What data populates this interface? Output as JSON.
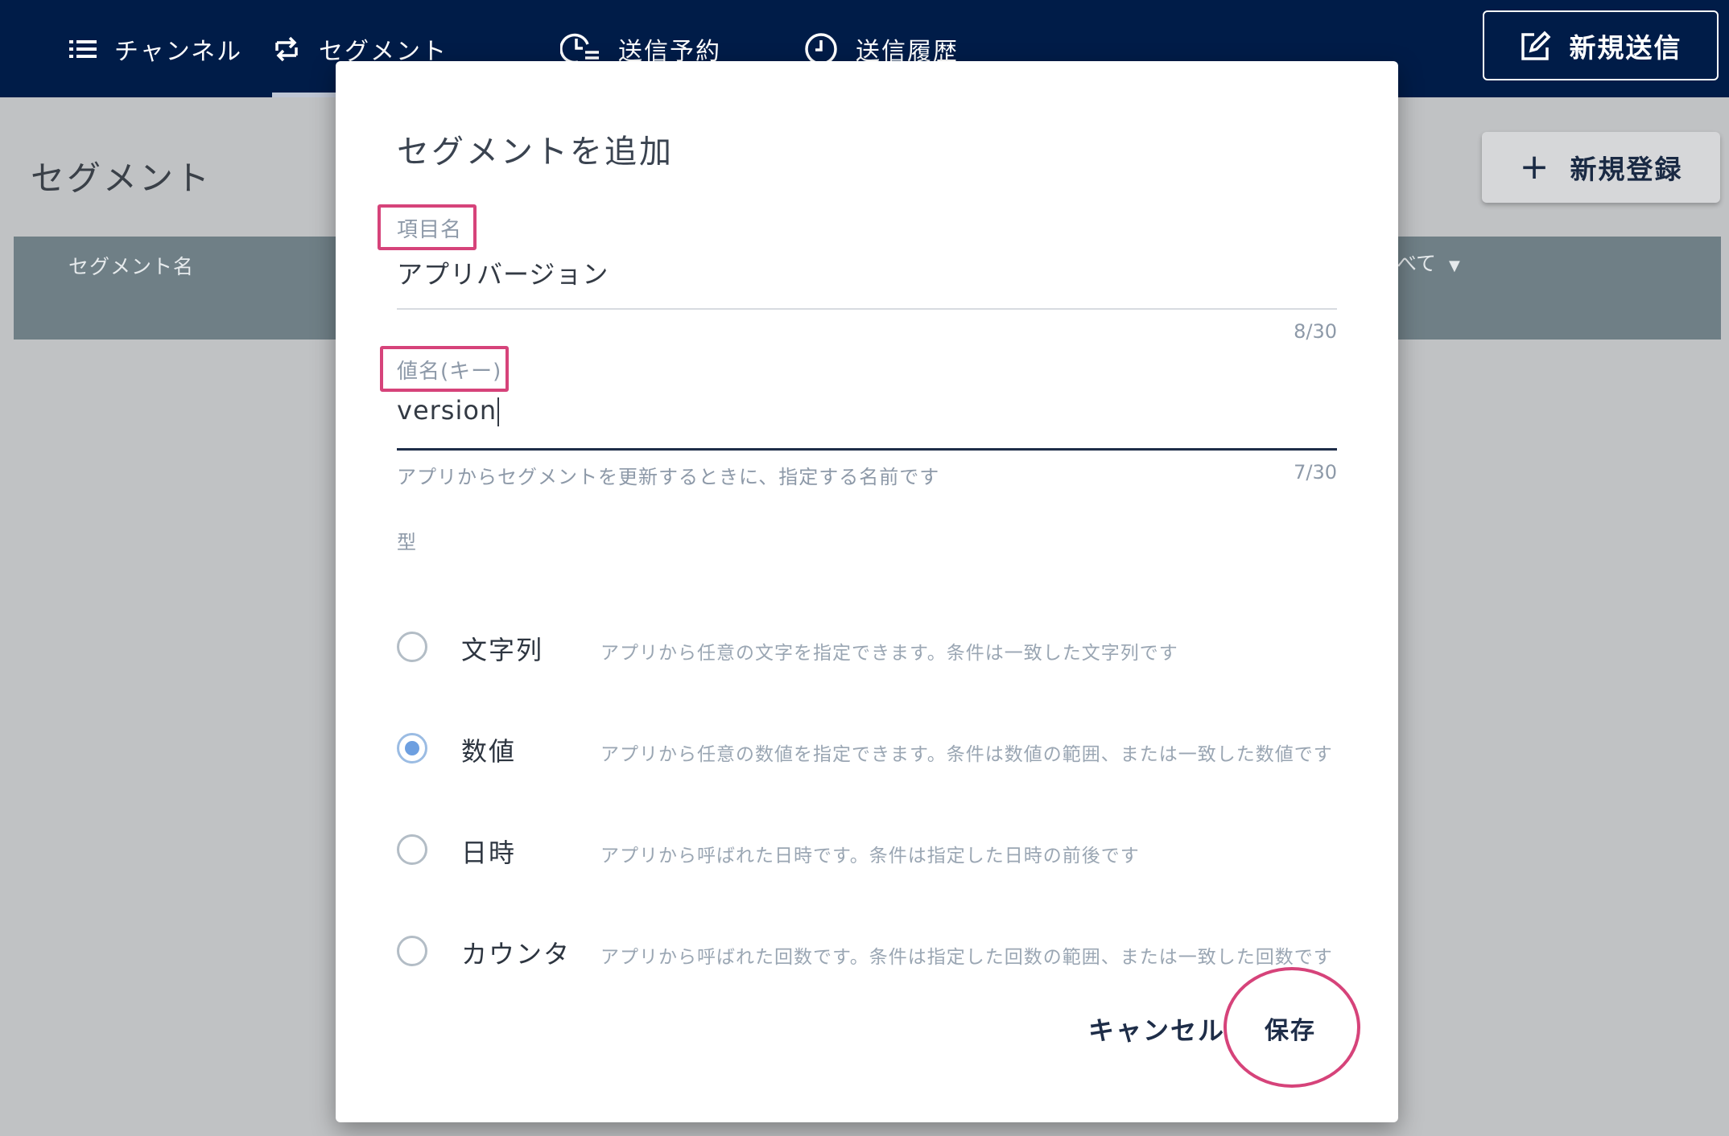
{
  "nav": {
    "items": [
      {
        "label": "チャンネル",
        "icon": "list-icon"
      },
      {
        "label": "セグメント",
        "icon": "swap-icon"
      },
      {
        "label": "送信予約",
        "icon": "clock-list-icon"
      },
      {
        "label": "送信履歴",
        "icon": "clock-icon"
      }
    ],
    "active_index": 1,
    "new_send_label": "新規送信"
  },
  "page": {
    "title": "セグメント",
    "register_label": "新規登録",
    "table": {
      "column_name": "セグメント名",
      "filter_partial": "べて"
    }
  },
  "modal": {
    "title": "セグメントを追加",
    "item_name": {
      "label": "項目名",
      "value": "アプリバージョン",
      "counter": "8/30"
    },
    "key_name": {
      "label": "値名(キー)",
      "value": "version",
      "helper": "アプリからセグメントを更新するときに、指定する名前です",
      "counter": "7/30"
    },
    "type": {
      "label": "型",
      "options": [
        {
          "label": "文字列",
          "description": "アプリから任意の文字を指定できます。条件は一致した文字列です",
          "selected": false
        },
        {
          "label": "数値",
          "description": "アプリから任意の数値を指定できます。条件は数値の範囲、または一致した数値です",
          "selected": true
        },
        {
          "label": "日時",
          "description": "アプリから呼ばれた日時です。条件は指定した日時の前後です",
          "selected": false
        },
        {
          "label": "カウンタ",
          "description": "アプリから呼ばれた回数です。条件は指定した回数の範囲、または一致した回数です",
          "selected": false
        }
      ]
    },
    "cancel_label": "キャンセル",
    "save_label": "保存"
  },
  "colors": {
    "navbar": "#001c48",
    "annotation": "#d6437a",
    "radio_selected": "#6d9fe0",
    "table_header": "#6f7f86"
  }
}
